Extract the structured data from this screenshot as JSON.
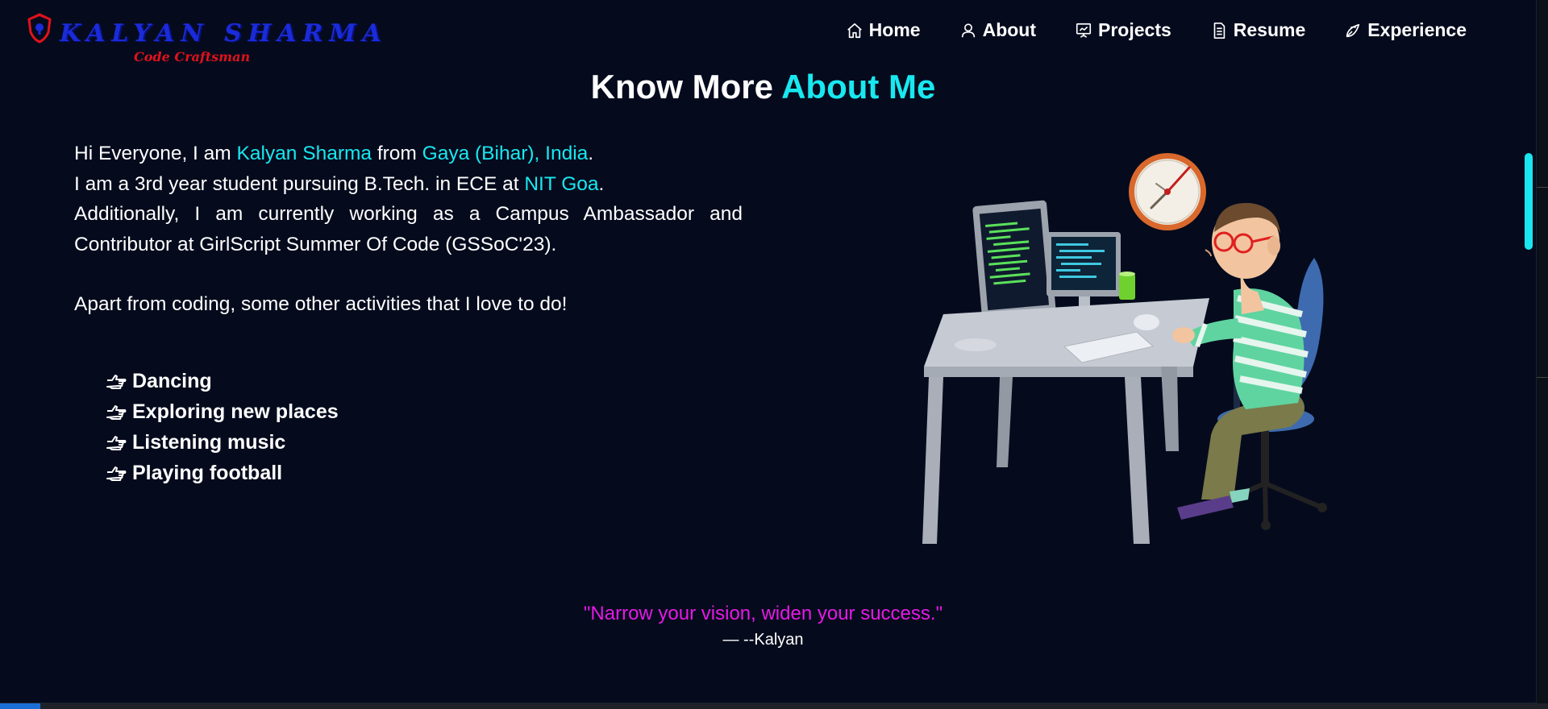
{
  "logo": {
    "title": "KALYAN SHARMA",
    "subtitle": "Code Craftsman",
    "colors": {
      "title": "#1a2bd9",
      "subtitle": "#e0121b",
      "shield": "#e0121b"
    }
  },
  "nav": {
    "items": [
      {
        "label": "Home",
        "icon": "home-icon"
      },
      {
        "label": "About",
        "icon": "user-icon"
      },
      {
        "label": "Projects",
        "icon": "presentation-icon"
      },
      {
        "label": "Resume",
        "icon": "document-icon"
      },
      {
        "label": "Experience",
        "icon": "rocket-icon"
      }
    ]
  },
  "heading": {
    "prefix": "Know More",
    "accent": "About Me"
  },
  "bio": {
    "line1": {
      "text1": "Hi Everyone, I am ",
      "name": "Kalyan Sharma",
      "text2": " from ",
      "place": "Gaya (Bihar), India",
      "text3": "."
    },
    "line2": {
      "text1": "I am a 3rd year student pursuing B.Tech. in ECE at ",
      "college": "NIT Goa",
      "text2": "."
    },
    "line3": "Additionally, I am currently working as a Campus Ambassador and Contributor at GirlScript Summer Of Code (GSSoC'23).",
    "line4": "Apart from coding, some other activities that I love to do!"
  },
  "hobbies": [
    "Dancing",
    "Exploring new places",
    "Listening music",
    "Playing football"
  ],
  "quote": {
    "text": "\"Narrow your vision, widen your success.\"",
    "author": "— --Kalyan"
  },
  "colors": {
    "background": "#050b1d",
    "accent": "#18e8f0",
    "quote": "#e619e6",
    "scrollbar": "#19e6f0"
  }
}
